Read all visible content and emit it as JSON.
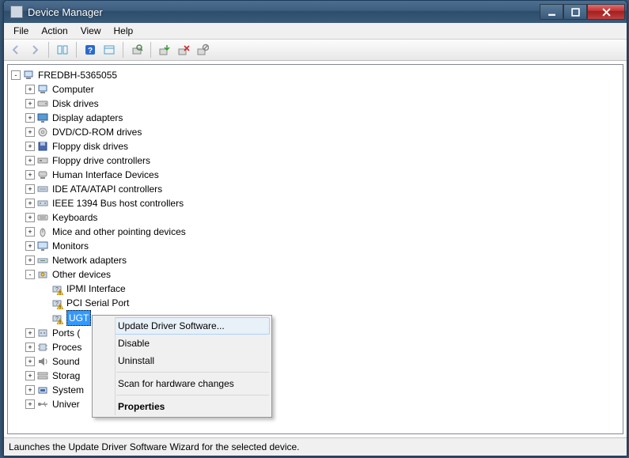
{
  "window": {
    "title": "Device Manager"
  },
  "menu": {
    "file": "File",
    "action": "Action",
    "view": "View",
    "help": "Help"
  },
  "toolbar_icons": [
    "back",
    "forward",
    "",
    "up",
    "show-hide",
    "",
    "help",
    "properties",
    "",
    "scan",
    "",
    "update",
    "uninstall",
    "disable"
  ],
  "tree": {
    "root": "FREDBH-5365055",
    "categories": [
      {
        "label": "Computer",
        "icon": "computer",
        "exp": "+"
      },
      {
        "label": "Disk drives",
        "icon": "disk",
        "exp": "+"
      },
      {
        "label": "Display adapters",
        "icon": "display",
        "exp": "+"
      },
      {
        "label": "DVD/CD-ROM drives",
        "icon": "cdrom",
        "exp": "+"
      },
      {
        "label": "Floppy disk drives",
        "icon": "floppy",
        "exp": "+"
      },
      {
        "label": "Floppy drive controllers",
        "icon": "floppyctrl",
        "exp": "+"
      },
      {
        "label": "Human Interface Devices",
        "icon": "hid",
        "exp": "+"
      },
      {
        "label": "IDE ATA/ATAPI controllers",
        "icon": "ide",
        "exp": "+"
      },
      {
        "label": "IEEE 1394 Bus host controllers",
        "icon": "1394",
        "exp": "+"
      },
      {
        "label": "Keyboards",
        "icon": "keyboard",
        "exp": "+"
      },
      {
        "label": "Mice and other pointing devices",
        "icon": "mouse",
        "exp": "+"
      },
      {
        "label": "Monitors",
        "icon": "monitor",
        "exp": "+"
      },
      {
        "label": "Network adapters",
        "icon": "network",
        "exp": "+"
      },
      {
        "label": "Other devices",
        "icon": "other",
        "exp": "-",
        "children": [
          {
            "label": "IPMI Interface",
            "icon": "unknown",
            "warn": true
          },
          {
            "label": "PCI Serial Port",
            "icon": "unknown",
            "warn": true
          },
          {
            "label": "UGT",
            "icon": "unknown",
            "warn": true,
            "selected": true
          }
        ]
      },
      {
        "label": "Ports (",
        "icon": "ports",
        "exp": "+"
      },
      {
        "label": "Proces",
        "icon": "processor",
        "exp": "+"
      },
      {
        "label": "Sound",
        "icon": "sound",
        "exp": "+"
      },
      {
        "label": "Storag",
        "icon": "storage",
        "exp": "+"
      },
      {
        "label": "System",
        "icon": "system",
        "exp": "+"
      },
      {
        "label": "Univer",
        "icon": "usb",
        "exp": "+"
      }
    ]
  },
  "context_menu": {
    "items": [
      {
        "label": "Update Driver Software...",
        "hover": true
      },
      {
        "label": "Disable"
      },
      {
        "label": "Uninstall"
      },
      {
        "sep": true
      },
      {
        "label": "Scan for hardware changes"
      },
      {
        "sep": true
      },
      {
        "label": "Properties",
        "bold": true
      }
    ]
  },
  "statusbar": {
    "text": "Launches the Update Driver Software Wizard for the selected device."
  }
}
